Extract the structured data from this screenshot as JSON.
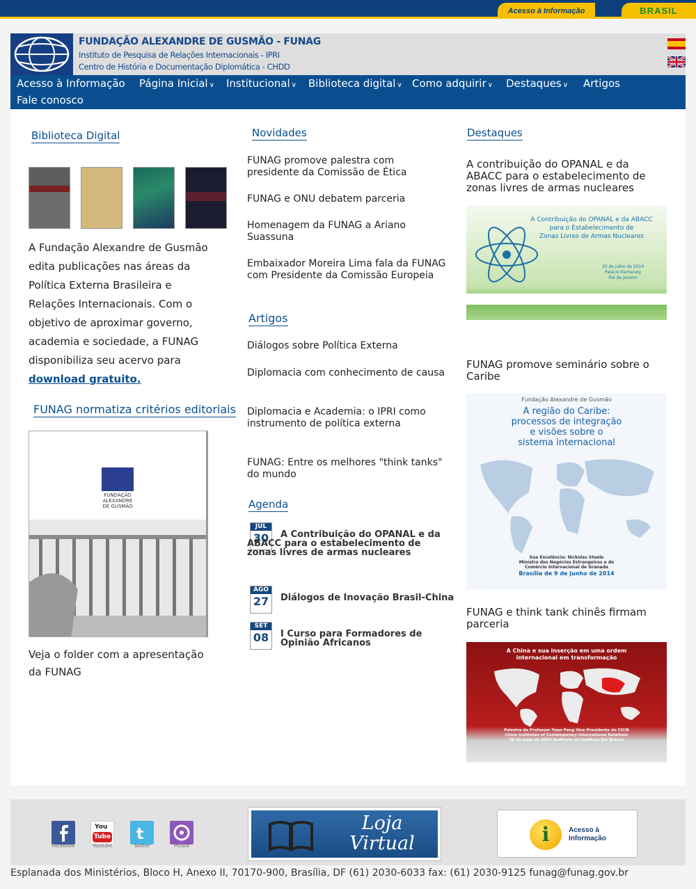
{
  "gov_bar": {
    "acesso_label": "Acesso à Informação",
    "brasil_label": "BRASIL"
  },
  "header": {
    "org_name": "FUNDAÇÃO ALEXANDRE DE GUSMÃO - FUNAG",
    "sub1": "Instituto de Pesquisa de Relações Internacionais - IPRI",
    "sub2": "Centro de História e Documentação Diplomática - CHDD"
  },
  "nav": {
    "items": [
      "Acesso à Informação",
      "Página Inicial",
      "Institucional",
      "Biblioteca digital",
      "Como adquirir",
      "Destaques",
      "Artigos",
      "Fale conosco"
    ]
  },
  "left": {
    "biblioteca_title": "Biblioteca Digital",
    "about_lines": [
      "A Fundação Alexandre de Gusmão",
      "edita publicações nas áreas da",
      "Política Externa Brasileira e",
      "Relações Internacionais. Com o",
      "objetivo de aproximar governo,",
      "academia e sociedade, a FUNAG",
      "disponibiliza seu acervo para"
    ],
    "download_link": "download gratuito.",
    "normatiza_title": "FUNAG normatiza critérios editoriais",
    "folder_logo_text": [
      "FUNDAÇÃO",
      "ALEXANDRE",
      "DE GUSMÃO"
    ],
    "folder_caption": [
      "Veja o folder com a apresentação",
      "da FUNAG"
    ]
  },
  "middle": {
    "novidades_title": "Novidades",
    "novidades": [
      "FUNAG promove palestra com presidente da Comissão de Ética",
      "FUNAG e ONU debatem parceria",
      "Homenagem da FUNAG a Ariano Suassuna",
      "Embaixador Moreira Lima fala da FUNAG com Presidente da Comissão Europeia"
    ],
    "artigos_title": "Artigos",
    "artigos": [
      "Diálogos sobre Política Externa",
      "Diplomacia com conhecimento de causa",
      "Diplomacia e Academia: o IPRI como instrumento de política externa",
      "FUNAG: Entre os melhores \"think tanks\" do mundo"
    ],
    "agenda_title": "Agenda",
    "agenda": [
      {
        "month": "JUL",
        "day": "30",
        "text": "A Contribuição do OPANAL e da ABACC para o estabelecimento de zonas livres de armas nucleares"
      },
      {
        "month": "AGO",
        "day": "27",
        "text": "Diálogos de Inovação Brasil-China"
      },
      {
        "month": "SET",
        "day": "08",
        "text": "I Curso para Formadores de Opinião Africanos"
      }
    ]
  },
  "right": {
    "destaques_title": "Destaques",
    "items": [
      {
        "title": "A contribuição do OPANAL e da ABACC para o estabelecimento de zonas livres de armas nucleares",
        "banner_lines": [
          "A Contribuição do OPANAL e da ABACC",
          "para o Estabelecimento de",
          "Zonas Livres de Armas Nucleares"
        ],
        "banner_date": [
          "30 de julho de 2014",
          "Palácio Itamaraty",
          "Rio de Janeiro"
        ]
      },
      {
        "title": "FUNAG promove seminário sobre o Caribe",
        "banner_top": "Fundação Alexandre de Gusmão",
        "banner_lines": [
          "A região do Caribe:",
          "processos de integração",
          "e visões sobre o",
          "sistema internacional"
        ],
        "banner_bottom": [
          "Sua Excelência: Nickolas Steele",
          "Ministro dos Negócios Estrangeiros e do",
          "Comércio Internacional de Granada",
          "Brasília de 9 de junho de 2014"
        ]
      },
      {
        "title": "FUNAG e think tank chinês firmam parceria",
        "banner_lines": [
          "A China e sua inserção em uma ordem",
          "internacional em transformação"
        ],
        "banner_bottom": [
          "Palestra do Professor Yuan Peng Vice-Presidente do CICIR",
          "China Institutes of Contemporary International Relations",
          "28 de maio de 2014 Auditório do Instituto Rio Branco"
        ]
      }
    ]
  },
  "footer": {
    "social": [
      "Facebook",
      "Youtube",
      "Twitter",
      "Picasa"
    ],
    "loja": [
      "Loja",
      "Virtual"
    ],
    "acesso": [
      "Acesso à",
      "Informação"
    ],
    "address": "Esplanada dos Ministérios, Bloco H, Anexo II, 70170-900, Brasília, DF (61) 2030-6033 fax: (61) 2030-9125 funag@funag.gov.br"
  },
  "colors": {
    "brand_blue": "#0a4e8f",
    "gov_blue": "#0d3f7d",
    "gov_yellow": "#f6c000"
  }
}
